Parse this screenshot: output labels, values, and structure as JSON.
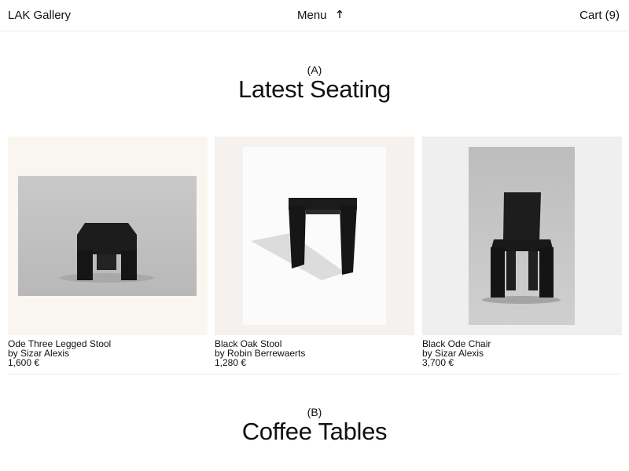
{
  "header": {
    "logo": "LAK Gallery",
    "menu_label": "Menu",
    "menu_icon": "arrow-up-icon",
    "cart_label": "Cart (9)"
  },
  "sections": [
    {
      "letter": "(A)",
      "title": "Latest Seating"
    },
    {
      "letter": "(B)",
      "title": "Coffee Tables"
    }
  ],
  "products": [
    {
      "name": "Ode Three Legged Stool",
      "maker": "by Sizar Alexis",
      "price": "1,600 €",
      "background": "#f9f6f0"
    },
    {
      "name": "Black Oak Stool",
      "maker": "by Robin Berrewaerts",
      "price": "1,280 €",
      "background": "#f5f1ef"
    },
    {
      "name": "Black Ode Chair",
      "maker": "by Sizar Alexis",
      "price": "3,700 €",
      "background": "#efefef"
    }
  ]
}
